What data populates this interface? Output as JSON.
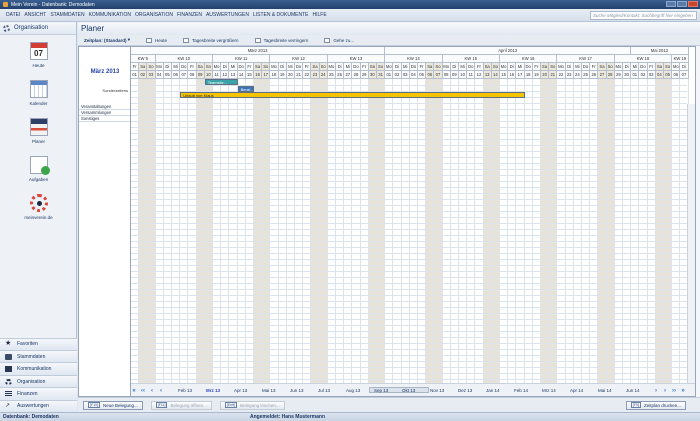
{
  "window": {
    "title": "Mein Verein - Datenbank: Demodaten"
  },
  "menu": [
    "DATEI",
    "ANSICHT",
    "STAMMDATEN",
    "KOMMUNIKATION",
    "ORGANISATION",
    "FINANZEN",
    "AUSWERTUNGEN",
    "LISTEN & DOKUMENTE",
    "HILFE"
  ],
  "search": {
    "placeholder": "Suche Mitglied/Kontakt: Suchbegriff hier eingeben"
  },
  "sidebar": {
    "header": "Organisation",
    "modules": [
      {
        "label": "Heute",
        "icon": "calendar-day-icon",
        "day": "07"
      },
      {
        "label": "Kalender",
        "icon": "calendar-month-icon"
      },
      {
        "label": "Planer",
        "icon": "planner-icon"
      },
      {
        "label": "Aufgaben",
        "icon": "tasks-icon"
      },
      {
        "label": "meinverein.de",
        "icon": "meinverein-logo-icon"
      }
    ],
    "nav": [
      {
        "label": "Favoriten",
        "icon": "star-icon"
      },
      {
        "label": "Stammdaten",
        "icon": "id-card-icon"
      },
      {
        "label": "Kommunikation",
        "icon": "envelope-icon"
      },
      {
        "label": "Organisation",
        "icon": "gear-icon"
      },
      {
        "label": "Finanzen",
        "icon": "coins-icon"
      },
      {
        "label": "Auswertungen",
        "icon": "chart-icon"
      }
    ]
  },
  "main": {
    "title": "Planer",
    "toolbar": {
      "zeitplan": "Zeitplan: (Standard)",
      "heute": "Heute",
      "zoom_in": "Tagesbreite vergrößern",
      "zoom_out": "Tagesbreite verringern",
      "goto": "Gehe zu..."
    },
    "date_label": "März 2013",
    "sonderzeiten": "Sonderzeitens",
    "months": [
      {
        "name": "März 2013",
        "startIdx": 0,
        "days": 31
      },
      {
        "name": "April 2013",
        "startIdx": 31,
        "days": 30
      },
      {
        "name": "Mai 2013",
        "startIdx": 61,
        "days": 7
      }
    ],
    "start_weekday_idx": 4,
    "start_day": 1,
    "weekday_abbr": [
      "Mo",
      "Di",
      "Mi",
      "Do",
      "Fr",
      "Sa",
      "So"
    ],
    "weeks": [
      "KW 9",
      "KW 10",
      "KW 11",
      "KW 12",
      "KW 13",
      "KW 14",
      "KW 15",
      "KW 16",
      "KW 17",
      "KW 18",
      "KW 19"
    ],
    "rows": [
      "Veranstaltungen",
      "Versammlungen",
      "Sonstiges"
    ],
    "events": [
      {
        "label": "Teamsitz...",
        "row": 0,
        "start": 9,
        "end": 13,
        "color": "#3aa3a7"
      },
      {
        "label": "Beral...",
        "row": 1,
        "start": 13,
        "end": 15,
        "color": "#3a73b8"
      },
      {
        "label": "Urlaub von Klaus",
        "row": 2,
        "start": 6,
        "end": 48,
        "color": "#f5c400"
      }
    ],
    "timeline": {
      "months": [
        "Feb 13",
        "Mrz 13",
        "Apr 13",
        "Mai 13",
        "Jun 13",
        "Jul 13",
        "Aug 13",
        "Sep 13",
        "Okt 13",
        "Nov 13",
        "Dez 13",
        "Jan 14",
        "Feb 14",
        "Mrz 14",
        "Apr 14",
        "Mai 14",
        "Jun 14"
      ],
      "current": "Mrz 13",
      "nav_left": [
        "«",
        "‹‹",
        "‹",
        "‹"
      ],
      "nav_right": [
        "›",
        "›",
        "››",
        "»"
      ]
    }
  },
  "bottom": {
    "new": {
      "key": "[F10]",
      "label": "Neue Belegung..."
    },
    "open": {
      "key": "[F11]",
      "label": "Belegung öffnen..."
    },
    "delete": {
      "key": "[Entf]",
      "label": "Belegung löschen..."
    },
    "print": {
      "key": "[F9]",
      "label": "Zeitplan drucken..."
    }
  },
  "status": {
    "db": "Datenbank: Demodaten",
    "user": "Angemeldet: Hans Mustermann"
  }
}
